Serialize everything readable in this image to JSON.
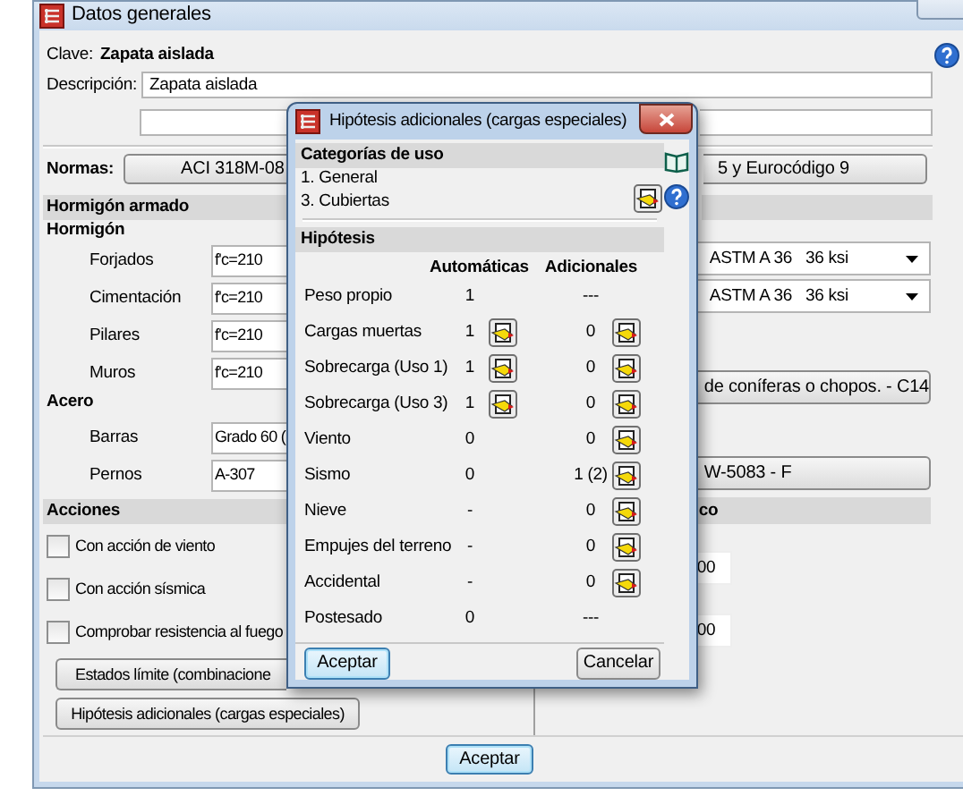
{
  "window": {
    "title": "Datos generales"
  },
  "clave": {
    "label": "Clave:",
    "value": "Zapata aislada"
  },
  "descripcion": {
    "label": "Descripción:",
    "value": "Zapata aislada"
  },
  "normas": {
    "label": "Normas:",
    "text_left": "ACI 318M-08",
    "text_right": "5 y Eurocódigo 9"
  },
  "section_title": "Hormigón armado",
  "groups": [
    {
      "title": "Hormigón",
      "rows": [
        {
          "label": "Forjados",
          "value": "f'c=210"
        },
        {
          "label": "Cimentación",
          "value": "f'c=210"
        },
        {
          "label": "Pilares",
          "value": "f'c=210"
        },
        {
          "label": "Muros",
          "value": "f'c=210"
        }
      ]
    },
    {
      "title": "Acero",
      "rows": [
        {
          "label": "Barras",
          "value": "Grado 60 ("
        },
        {
          "label": "Pernos",
          "value": "A-307"
        }
      ]
    }
  ],
  "acciones": {
    "title": "Acciones",
    "options": [
      {
        "label": "Con acción de viento",
        "checked": false
      },
      {
        "label": "Con acción sísmica",
        "checked": false
      },
      {
        "label": "Comprobar resistencia al fuego",
        "checked": false
      }
    ],
    "buttons": [
      "Estados límite (combinacione",
      "Hipótesis adicionales (cargas especiales)"
    ]
  },
  "right_column": [
    {
      "kind": "dropdown",
      "text": "ASTM A 36   36 ksi"
    },
    {
      "kind": "dropdown",
      "text": "ASTM A 36   36 ksi"
    },
    {
      "kind": "button",
      "text": "de coníferas o chopos. - C14"
    },
    {
      "kind": "button",
      "text": "W-5083 - F"
    },
    {
      "kind": "header",
      "text": "co"
    },
    {
      "kind": "field",
      "text": "00"
    },
    {
      "kind": "field",
      "text": "00"
    }
  ],
  "footer": {
    "button": "Aceptar",
    "focused": true
  },
  "dialog": {
    "title": "Hipótesis adicionales (cargas especiales)",
    "categories_title": "Categorías de uso",
    "categories": [
      "1. General",
      "3. Cubiertas"
    ],
    "hypotheses_title": "Hipótesis",
    "columns": [
      "Automáticas",
      "Adicionales"
    ],
    "rows": [
      {
        "name": "Peso propio",
        "auto": "1",
        "auto_button": false,
        "additional": "---",
        "additional_button": false
      },
      {
        "name": "Cargas muertas",
        "auto": "1",
        "auto_button": true,
        "additional": "0",
        "additional_button": true
      },
      {
        "name": "Sobrecarga (Uso 1)",
        "auto": "1",
        "auto_button": true,
        "additional": "0",
        "additional_button": true
      },
      {
        "name": "Sobrecarga (Uso 3)",
        "auto": "1",
        "auto_button": true,
        "additional": "0",
        "additional_button": true
      },
      {
        "name": "Viento",
        "auto": "0",
        "auto_button": false,
        "additional": "0",
        "additional_button": true
      },
      {
        "name": "Sismo",
        "auto": "0",
        "auto_button": false,
        "additional": "1 (2)",
        "additional_button": true
      },
      {
        "name": "Nieve",
        "auto": "-",
        "auto_button": false,
        "additional": "0",
        "additional_button": true
      },
      {
        "name": "Empujes del terreno",
        "auto": "-",
        "auto_button": false,
        "additional": "0",
        "additional_button": true
      },
      {
        "name": "Accidental",
        "auto": "-",
        "auto_button": false,
        "additional": "0",
        "additional_button": true
      },
      {
        "name": "Postesado",
        "auto": "0",
        "auto_button": false,
        "additional": "---",
        "additional_button": false
      }
    ],
    "buttons": [
      {
        "label": "Aceptar",
        "focused": true
      },
      {
        "label": "Cancelar",
        "focused": false
      }
    ]
  }
}
